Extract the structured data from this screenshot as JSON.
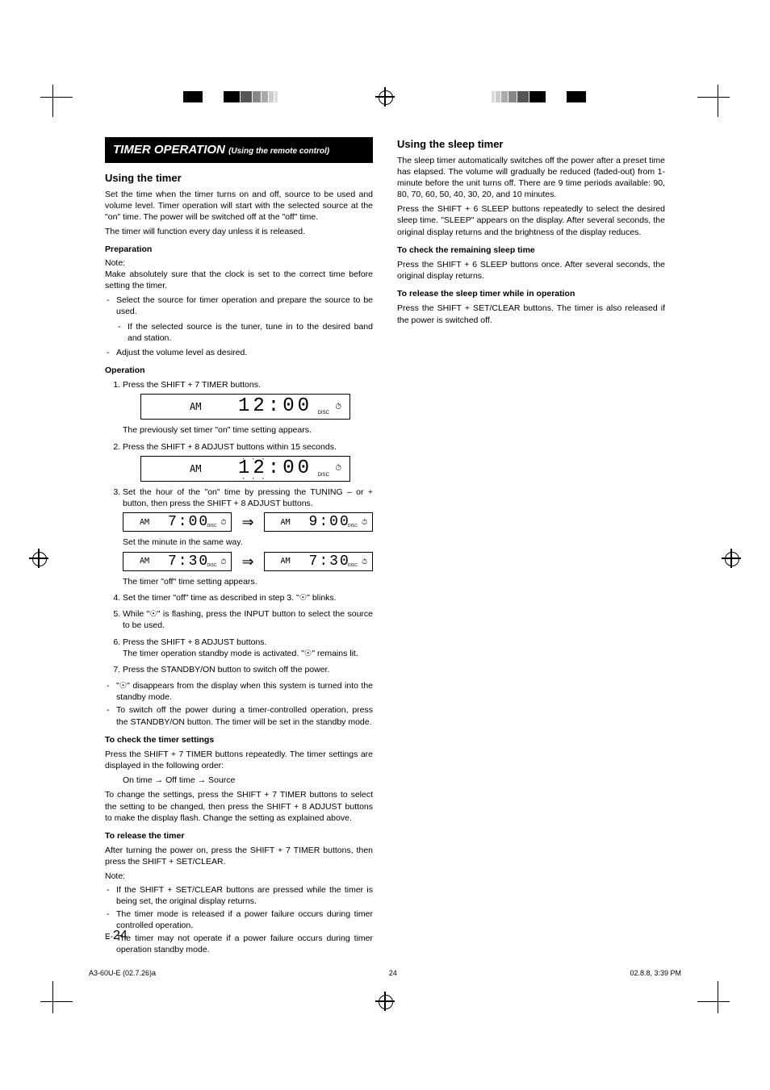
{
  "header": {
    "title": "TIMER OPERATION",
    "subtitle": "(Using the remote control)"
  },
  "left": {
    "using_timer_h": "Using the timer",
    "using_timer_p1": "Set the time when the timer turns on and off, source to be used and volume level. Timer operation will start with the selected source at the \"on\" time. The power will be switched off at the \"off\" time.",
    "using_timer_p2": "The timer will function every day unless it is released.",
    "prep_h": "Preparation",
    "prep_note_label": "Note:",
    "prep_note": "Make absolutely sure that the clock is set to the correct time before setting the timer.",
    "prep_li1": "Select the source for timer operation and prepare the source to be used.",
    "prep_li1a": "If the selected source is the tuner, tune in to the desired band and station.",
    "prep_li2": "Adjust the volume level as desired.",
    "op_h": "Operation",
    "op_li1": "Press the SHIFT + 7 TIMER buttons.",
    "op_after1": "The previously set timer \"on\" time setting appears.",
    "op_li2": "Press the SHIFT + 8 ADJUST buttons within 15 seconds.",
    "op_li3": "Set the hour of the \"on\" time by pressing the TUNING – or + button, then press the SHIFT + 8 ADJUST buttons.",
    "op_set_minute": "Set the minute in the same way.",
    "op_off_appears": "The timer \"off\" time setting appears.",
    "op_li4": "Set the timer \"off\" time as described in step 3. \"☉\" blinks.",
    "op_li5": "While \"☉\" is flashing, press the INPUT button  to select the source to be used.",
    "op_li6": "Press the SHIFT + 8 ADJUST buttons.",
    "op_li6_sub": "The timer operation standby mode is activated. \"☉\" remains lit.",
    "op_li7": "Press the STANDBY/ON button to switch off the power.",
    "op_note1": "\"☉\" disappears from the display when this system is turned into the standby mode.",
    "op_note2": "To switch off the power during a timer-controlled operation, press the STANDBY/ON button. The timer will be set in the standby mode.",
    "check_h": "To check the timer settings",
    "check_p": "Press the SHIFT + 7 TIMER buttons repeatedly. The timer settings are displayed in the following order:",
    "seq1": "On time",
    "seq2": "Off time",
    "seq3": "Source",
    "check_p2": "To change the settings, press the SHIFT + 7 TIMER buttons to select the setting to be changed, then press the SHIFT + 8 ADJUST buttons to make the display flash. Change the setting as explained above.",
    "release_h": "To release the timer",
    "release_p": "After turning the power on, press the SHIFT + 7 TIMER buttons, then press the SHIFT + SET/CLEAR.",
    "release_note_label": "Note:",
    "release_n1": "If the SHIFT + SET/CLEAR buttons are pressed while the timer is being set, the original display returns.",
    "release_n2": "The timer mode is released if a power failure occurs during timer controlled operation.",
    "release_n3": "The timer may not operate if a power failure occurs during timer operation standby mode."
  },
  "right": {
    "sleep_h": "Using the sleep timer",
    "sleep_p1": "The sleep timer automatically switches off the power after a preset time has elapsed. The volume will gradually be reduced (faded-out) from 1-minute before the unit turns off. There are 9 time periods available: 90, 80, 70, 60, 50, 40, 30, 20, and 10 minutes.",
    "sleep_p2": "Press the SHIFT + 6 SLEEP buttons repeatedly to select the desired sleep time. \"SLEEP\" appears on the display. After several seconds, the original display returns and the brightness of the display reduces.",
    "check_sleep_h": "To check the remaining sleep time",
    "check_sleep_p": "Press the SHIFT + 6 SLEEP buttons once. After several seconds, the original display returns.",
    "release_sleep_h": "To release the sleep timer while in operation",
    "release_sleep_p": "Press the SHIFT + SET/CLEAR buttons. The timer is also released if the power is switched off."
  },
  "lcd": {
    "ampm": "AM",
    "t1200": "12:00",
    "t700": "7:00",
    "t900": "9:00",
    "t730": "7:30",
    "disk": "DISC"
  },
  "page": {
    "prefix": "E-",
    "num": "24"
  },
  "footer": {
    "left": "A3-60U-E (02.7.26)a",
    "mid": "24",
    "right": "02.8.8, 3:39 PM"
  }
}
